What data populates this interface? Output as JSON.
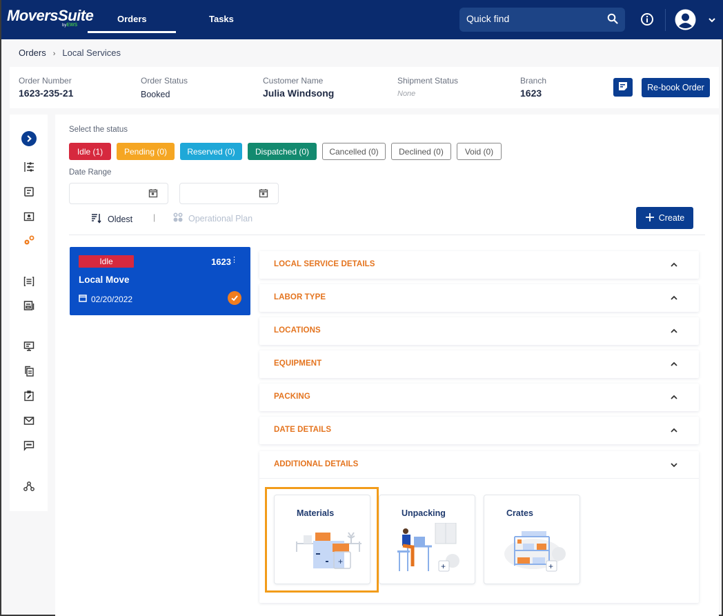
{
  "app": {
    "brand": "MoversSuite",
    "brand_sub_prefix": "by",
    "brand_sub": "EWS"
  },
  "nav": {
    "tabs": [
      {
        "label": "Orders",
        "active": true
      },
      {
        "label": "Tasks",
        "active": false
      }
    ]
  },
  "search": {
    "placeholder": "Quick find"
  },
  "breadcrumb": {
    "items": [
      "Orders",
      "Local Services"
    ],
    "separator": "›"
  },
  "order": {
    "order_number_label": "Order Number",
    "order_number": "1623-235-21",
    "order_status_label": "Order Status",
    "order_status": "Booked",
    "customer_name_label": "Customer Name",
    "customer_name": "Julia Windsong",
    "shipment_status_label": "Shipment Status",
    "shipment_status": "None",
    "branch_label": "Branch",
    "branch": "1623",
    "rebook_label": "Re-book Order"
  },
  "sidebar": {
    "icons": [
      "expand-icon",
      "sliders-icon",
      "document-icon",
      "folder-user-icon",
      "gears-icon",
      "list-icon",
      "newspaper-icon",
      "monitor-icon",
      "copy-document-icon",
      "clipboard-edit-icon",
      "mail-icon",
      "chat-icon",
      "network-icon"
    ],
    "active": "gears-icon",
    "accent": "#f07d1f"
  },
  "filters": {
    "status_label": "Select the status",
    "statuses": [
      {
        "label": "Idle (1)",
        "color": "#d6293e",
        "filled": true
      },
      {
        "label": "Pending (0)",
        "color": "#f5a623",
        "filled": true
      },
      {
        "label": "Reserved (0)",
        "color": "#1fa8d8",
        "filled": true
      },
      {
        "label": "Dispatched (0)",
        "color": "#138a6f",
        "filled": true
      },
      {
        "label": "Cancelled (0)",
        "filled": false
      },
      {
        "label": "Declined (0)",
        "filled": false
      },
      {
        "label": "Void (0)",
        "filled": false
      }
    ],
    "date_range_label": "Date Range",
    "date_from": "",
    "date_to": "",
    "sort_label": "Oldest",
    "operational_plan_label": "Operational Plan",
    "create_label": "Create"
  },
  "service_card": {
    "status": "Idle",
    "branch": "1623",
    "title": "Local Move",
    "date": "02/20/2022",
    "selected": true
  },
  "sections": [
    {
      "title": "LOCAL SERVICE DETAILS",
      "expanded": false
    },
    {
      "title": "LABOR TYPE",
      "expanded": false
    },
    {
      "title": "LOCATIONS",
      "expanded": false
    },
    {
      "title": "EQUIPMENT",
      "expanded": false
    },
    {
      "title": "PACKING",
      "expanded": false
    },
    {
      "title": "DATE DETAILS",
      "expanded": false
    },
    {
      "title": "ADDITIONAL DETAILS",
      "expanded": true
    }
  ],
  "additional_tiles": [
    {
      "label": "Materials",
      "highlighted": true
    },
    {
      "label": "Unpacking",
      "highlighted": false
    },
    {
      "label": "Crates",
      "highlighted": false
    }
  ]
}
